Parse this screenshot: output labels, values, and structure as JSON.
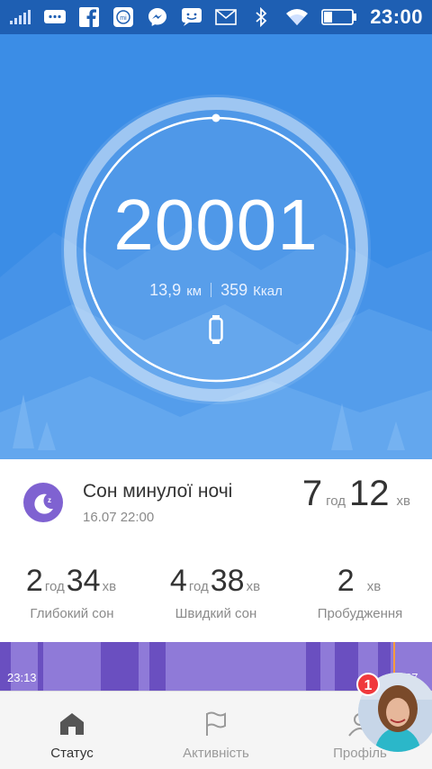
{
  "status_bar": {
    "time": "23:00",
    "left_icons": [
      "signal-icon",
      "message-icon",
      "facebook-icon",
      "mi-fit-icon",
      "messenger-icon",
      "chat-icon",
      "email-icon"
    ],
    "right_icons": [
      "bluetooth-icon",
      "wifi-icon",
      "battery-icon"
    ],
    "battery_level": 0.3
  },
  "activity": {
    "steps": "20001",
    "distance_value": "13,9",
    "distance_unit": "км",
    "calories_value": "359",
    "calories_unit": "Ккал",
    "accent_color": "#3b8de6"
  },
  "sleep": {
    "title": "Сон минулої ночі",
    "date": "16.07 22:00",
    "total_hours": "7",
    "total_hours_unit": "год",
    "total_minutes": "12",
    "total_minutes_unit": "хв",
    "deep": {
      "hours": "2",
      "hours_unit": "год",
      "minutes": "34",
      "minutes_unit": "хв",
      "label": "Глибокий сон"
    },
    "rem": {
      "hours": "4",
      "hours_unit": "год",
      "minutes": "38",
      "minutes_unit": "хв",
      "label": "Швидкий сон"
    },
    "awake": {
      "value": "2",
      "unit": "хв",
      "label": "Пробудження"
    },
    "chart": {
      "start_label": "23:13",
      "end_label": "06:27",
      "deep_color": "#6a4fc0",
      "light_color": "#8f7ad8"
    }
  },
  "nav": {
    "items": [
      {
        "label": "Статус",
        "icon": "home-icon",
        "active": true
      },
      {
        "label": "Активність",
        "icon": "flag-icon",
        "active": false
      },
      {
        "label": "Профіль",
        "icon": "profile-icon",
        "active": false
      }
    ]
  },
  "chat_head": {
    "badge_count": "1"
  }
}
